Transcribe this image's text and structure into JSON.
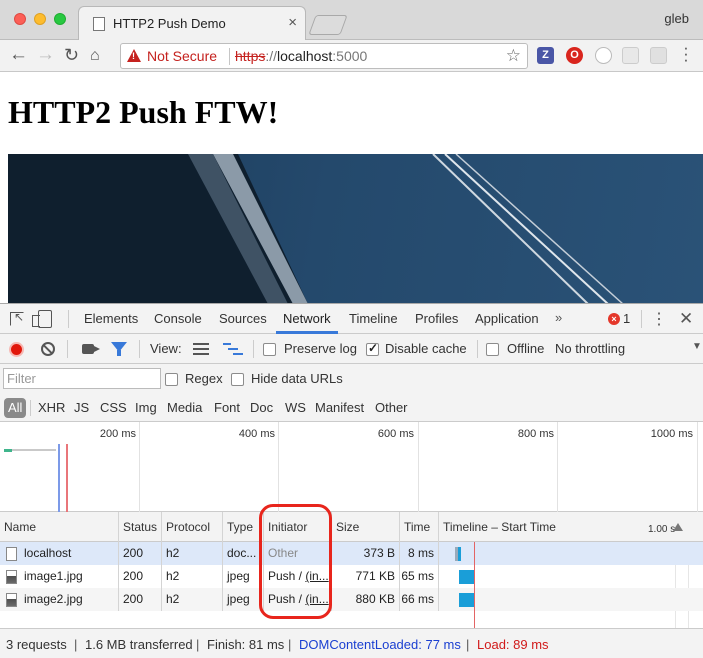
{
  "browser": {
    "tab_title": "HTTP2 Push Demo",
    "tab_close": "×",
    "profile": "gleb",
    "security_label": "Not Secure",
    "url_scheme": "https",
    "url_sep": "://",
    "url_host": "localhost",
    "url_port": ":5000",
    "ext_z": "Z",
    "ext_o": "O"
  },
  "page": {
    "heading": "HTTP2 Push FTW!"
  },
  "devtools": {
    "tabs": [
      "Elements",
      "Console",
      "Sources",
      "Network",
      "Timeline",
      "Profiles",
      "Application"
    ],
    "active_tab": "Network",
    "more": "»",
    "error_count": "1",
    "error_badge": "×",
    "close": "✕",
    "kebab": "⋮"
  },
  "network_toolbar": {
    "view_label": "View:",
    "preserve_log": "Preserve log",
    "preserve_log_checked": false,
    "disable_cache": "Disable cache",
    "disable_cache_checked": true,
    "offline": "Offline",
    "offline_checked": false,
    "throttling": "No throttling",
    "throttle_arrow": "▼"
  },
  "filter_bar": {
    "placeholder": "Filter",
    "regex": "Regex",
    "hide_data_urls": "Hide data URLs"
  },
  "type_filters": [
    "All",
    "XHR",
    "JS",
    "CSS",
    "Img",
    "Media",
    "Font",
    "Doc",
    "WS",
    "Manifest",
    "Other"
  ],
  "overview": {
    "ticks": [
      "200 ms",
      "400 ms",
      "600 ms",
      "800 ms",
      "1000 ms"
    ]
  },
  "table": {
    "columns": [
      "Name",
      "Status",
      "Protocol",
      "Type",
      "Initiator",
      "Size",
      "Time",
      "Timeline – Start Time"
    ],
    "timeline_scale": "1.00 s",
    "rows": [
      {
        "name": "localhost",
        "status": "200",
        "protocol": "h2",
        "type": "doc...",
        "initiator_a": "Other",
        "initiator_b": "",
        "size": "373 B",
        "time": "8 ms"
      },
      {
        "name": "image1.jpg",
        "status": "200",
        "protocol": "h2",
        "type": "jpeg",
        "initiator_a": "Push / ",
        "initiator_b": "(in...",
        "size": "771 KB",
        "time": "65 ms"
      },
      {
        "name": "image2.jpg",
        "status": "200",
        "protocol": "h2",
        "type": "jpeg",
        "initiator_a": "Push / ",
        "initiator_b": "(in...",
        "size": "880 KB",
        "time": "66 ms"
      }
    ]
  },
  "status_bar": {
    "requests": "3 requests",
    "transferred": "1.6 MB transferred",
    "finish": "Finish: 81 ms",
    "dom_content_loaded": "DOMContentLoaded: 77 ms",
    "load": "Load: 89 ms",
    "separator": "|"
  },
  "colors": {
    "accent": "#3879d9",
    "not_secure": "#c5221f",
    "dcl": "#1a3fd1",
    "load": "#d11a1a",
    "highlight": "#e8251c"
  }
}
